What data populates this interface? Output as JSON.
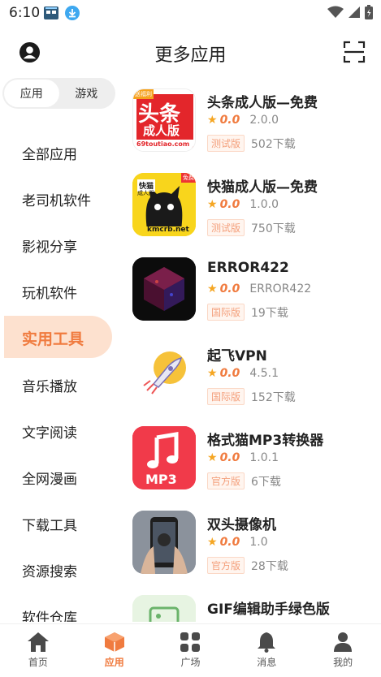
{
  "status": {
    "time": "6:10"
  },
  "header": {
    "title": "更多应用"
  },
  "toggle": {
    "apps_label": "应用",
    "games_label": "游戏"
  },
  "categories": [
    {
      "label": "全部应用"
    },
    {
      "label": "老司机软件"
    },
    {
      "label": "影视分享"
    },
    {
      "label": "玩机软件"
    },
    {
      "label": "实用工具",
      "active": true
    },
    {
      "label": "音乐播放"
    },
    {
      "label": "文字阅读"
    },
    {
      "label": "全网漫画"
    },
    {
      "label": "下载工具"
    },
    {
      "label": "资源搜索"
    },
    {
      "label": "软件仓库"
    }
  ],
  "apps": [
    {
      "name": "头条成人版—免费",
      "rating": "0.0",
      "version": "2.0.0",
      "badge": "测试版",
      "downloads": "502下载",
      "icon_text": "头条",
      "icon_sub": "成人版",
      "icon_foot": "69toutiao.com",
      "icon_label": "送福利"
    },
    {
      "name": "快猫成人版—免费",
      "rating": "0.0",
      "version": "1.0.0",
      "badge": "测试版",
      "downloads": "750下载",
      "icon_text": "快猫",
      "icon_sub": "成人版",
      "icon_foot": "kmcrb.net",
      "icon_label": "免费"
    },
    {
      "name": "ERROR422",
      "rating": "0.0",
      "version": "ERROR422",
      "badge": "国际版",
      "downloads": "19下载"
    },
    {
      "name": "起飞VPN",
      "rating": "0.0",
      "version": "4.5.1",
      "badge": "国际版",
      "downloads": "152下载"
    },
    {
      "name": "格式猫MP3转换器",
      "rating": "0.0",
      "version": "1.0.1",
      "badge": "官方版",
      "downloads": "6下载",
      "icon_text": "MP3"
    },
    {
      "name": "双头摄像机",
      "rating": "0.0",
      "version": "1.0",
      "badge": "官方版",
      "downloads": "28下载"
    },
    {
      "name": "GIF编辑助手绿色版",
      "rating": "",
      "version": "",
      "badge": "",
      "downloads": ""
    }
  ],
  "nav": [
    {
      "label": "首页",
      "icon": "home-icon"
    },
    {
      "label": "应用",
      "icon": "apps-cube-icon",
      "active": true
    },
    {
      "label": "广场",
      "icon": "grid-icon"
    },
    {
      "label": "消息",
      "icon": "bell-icon"
    },
    {
      "label": "我的",
      "icon": "profile-icon"
    }
  ],
  "colors": {
    "accent": "#f07b3f",
    "active_bg": "#fde1cf",
    "star": "#f5a623"
  }
}
